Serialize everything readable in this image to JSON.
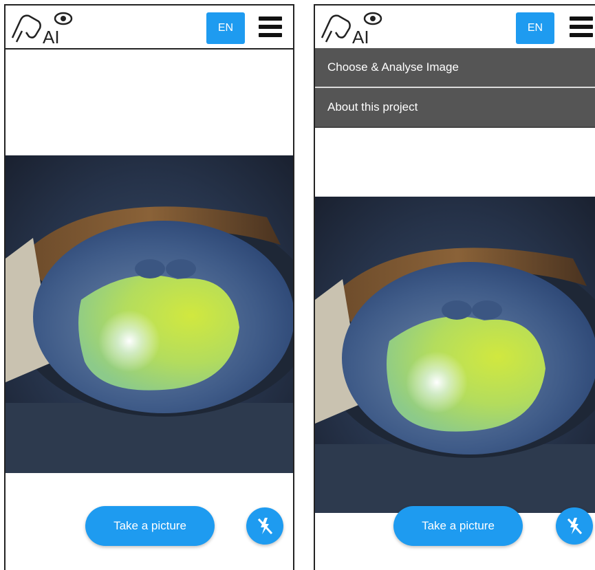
{
  "left_screen": {
    "header": {
      "lang_label": "EN"
    },
    "take_picture_label": "Take a picture"
  },
  "right_screen": {
    "header": {
      "lang_label": "EN"
    },
    "menu": {
      "items": [
        {
          "label": "Choose & Analyse Image"
        },
        {
          "label": "About this project"
        }
      ]
    },
    "take_picture_label": "Take a picture"
  },
  "colors": {
    "accent": "#1e9bf0",
    "drawer_bg": "#555555",
    "lesion_highlight": "#c6ef3e"
  },
  "icons": [
    "horse-eye-logo-icon",
    "hamburger-menu-icon",
    "flash-off-icon"
  ]
}
